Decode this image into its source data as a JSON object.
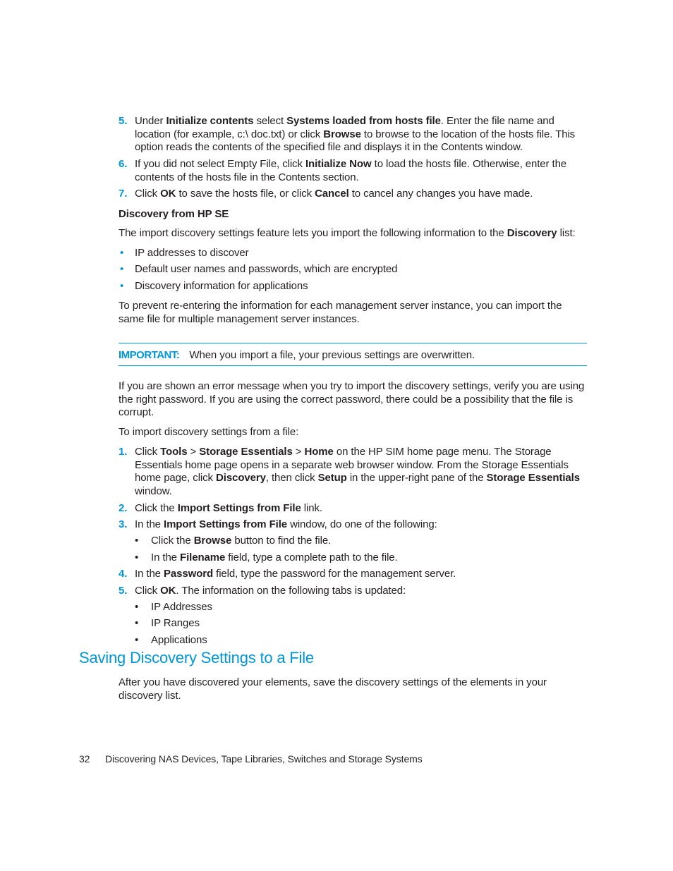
{
  "steps_top": [
    {
      "num": "5.",
      "parts": [
        {
          "t": "Under "
        },
        {
          "b": "Initialize contents"
        },
        {
          "t": " select "
        },
        {
          "b": "Systems loaded from hosts file"
        },
        {
          "t": ". Enter the file name and location (for example, c:\\ doc.txt) or click "
        },
        {
          "b": "Browse"
        },
        {
          "t": " to browse to the location of the hosts file. This option reads the contents of the specified file and displays it in the Contents window."
        }
      ]
    },
    {
      "num": "6.",
      "parts": [
        {
          "t": "If you did not select Empty File, click "
        },
        {
          "b": "Initialize Now"
        },
        {
          "t": " to load the hosts file. Otherwise, enter the contents of the hosts file in the Contents section."
        }
      ]
    },
    {
      "num": "7.",
      "parts": [
        {
          "t": "Click "
        },
        {
          "b": "OK"
        },
        {
          "t": " to save the hosts file, or click "
        },
        {
          "b": "Cancel"
        },
        {
          "t": " to cancel any changes you have made."
        }
      ]
    }
  ],
  "section_heading": "Discovery from HP SE",
  "intro": [
    {
      "t": "The import discovery settings feature lets you import the following information to the "
    },
    {
      "b": "Discovery"
    },
    {
      "t": " list:"
    }
  ],
  "bullets": [
    "IP addresses to discover",
    "Default user names and passwords, which are encrypted",
    "Discovery information for applications"
  ],
  "prevent_para": "To prevent re-entering the information for each management server instance, you can import the same file for multiple management server instances.",
  "important": {
    "label": "IMPORTANT:",
    "text": "When you import a file, your previous settings are overwritten."
  },
  "error_para": "If you are shown an error message when you try to import the discovery settings, verify you are using the right password. If you are using the correct password, there could be a possibility that the file is corrupt.",
  "import_intro": "To import discovery settings from a file:",
  "steps_import": [
    {
      "num": "1.",
      "parts": [
        {
          "t": "Click "
        },
        {
          "b": "Tools"
        },
        {
          "t": " > "
        },
        {
          "b": "Storage Essentials"
        },
        {
          "t": " > "
        },
        {
          "b": "Home"
        },
        {
          "t": " on the HP SIM home page menu. The Storage Essentials home page opens in a separate web browser window. From the Storage Essentials home page, click "
        },
        {
          "b": "Discovery"
        },
        {
          "t": ", then click "
        },
        {
          "b": "Setup"
        },
        {
          "t": " in the upper-right pane of the "
        },
        {
          "b": "Storage Essentials"
        },
        {
          "t": " window."
        }
      ]
    },
    {
      "num": "2.",
      "parts": [
        {
          "t": "Click the "
        },
        {
          "b": "Import Settings from File"
        },
        {
          "t": " link."
        }
      ]
    },
    {
      "num": "3.",
      "parts": [
        {
          "t": "In the "
        },
        {
          "b": "Import Settings from File"
        },
        {
          "t": " window, do one of the following:"
        }
      ]
    },
    {
      "num": "4.",
      "parts": [
        {
          "t": "In the "
        },
        {
          "b": "Password"
        },
        {
          "t": " field, type the password for the management server."
        }
      ]
    },
    {
      "num": "5.",
      "parts": [
        {
          "t": "Click "
        },
        {
          "b": "OK"
        },
        {
          "t": ". The information on the following tabs is updated:"
        }
      ]
    }
  ],
  "step3_subs": [
    [
      {
        "t": "Click the "
      },
      {
        "b": "Browse"
      },
      {
        "t": " button to find the file."
      }
    ],
    [
      {
        "t": "In the "
      },
      {
        "b": "Filename"
      },
      {
        "t": " field, type a complete path to the file."
      }
    ]
  ],
  "step5_subs": [
    "IP Addresses",
    "IP Ranges",
    "Applications"
  ],
  "saving_heading": "Saving Discovery Settings to a File",
  "saving_para": "After you have discovered your elements, save the discovery settings of the elements in your discovery list.",
  "footer": {
    "page_number": "32",
    "title": "Discovering NAS Devices, Tape Libraries, Switches and Storage Systems"
  },
  "colors": {
    "accent": "#0096d6",
    "text": "#231f20"
  }
}
